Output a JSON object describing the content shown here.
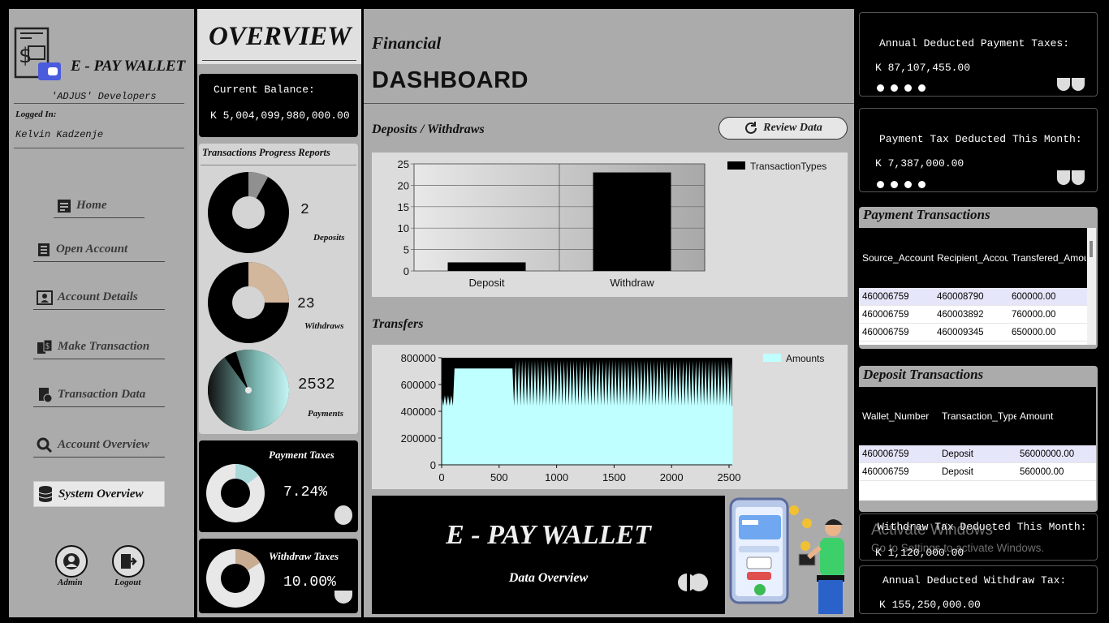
{
  "app": {
    "name": "E - PAY WALLET",
    "developers": "'ADJUS' Developers",
    "logged_in_label": "Logged In:",
    "user": "Kelvin Kadzenje"
  },
  "nav": [
    {
      "label": "Home",
      "icon": "home-icon"
    },
    {
      "label": "Open Account",
      "icon": "form-icon"
    },
    {
      "label": "Account Details",
      "icon": "id-card-icon"
    },
    {
      "label": "Make Transaction",
      "icon": "money-transfer-icon"
    },
    {
      "label": "Transaction Data",
      "icon": "document-icon"
    },
    {
      "label": "Account Overview",
      "icon": "search-icon"
    },
    {
      "label": "System Overview",
      "icon": "database-icon"
    }
  ],
  "footer": {
    "admin": "Admin",
    "logout": "Logout"
  },
  "overview": {
    "title": "OVERVIEW",
    "balance_label": "Current Balance:",
    "balance_value": "K 5,004,099,980,000.00",
    "progress_title": "Transactions Progress Reports",
    "deposits": {
      "count": "2",
      "label": "Deposits",
      "fraction": 0.08
    },
    "withdraws": {
      "count": "23",
      "label": "Withdraws",
      "fraction": 0.25
    },
    "payments": {
      "count": "2532",
      "label": "Payments",
      "fraction": 0.95
    },
    "payment_taxes": {
      "label": "Payment Taxes",
      "value": "7.24%",
      "fraction": 0.0724
    },
    "withdraw_taxes": {
      "label": "Withdraw Taxes",
      "value": "10.00%",
      "fraction": 0.1
    }
  },
  "dashboard": {
    "title_small": "Financial",
    "title_big": "DASHBOARD",
    "deposits_title": "Deposits / Withdraws",
    "review_button": "Review Data",
    "transfers_title": "Transfers",
    "banner_title": "E - PAY WALLET",
    "banner_sub": "Data Overview"
  },
  "chart_data": [
    {
      "type": "bar",
      "categories": [
        "Deposit",
        "Withdraw"
      ],
      "series": [
        {
          "name": "TransactionTypes",
          "values": [
            2,
            23
          ]
        }
      ],
      "ylim": [
        0,
        25
      ],
      "yticks": [
        "25",
        "20",
        "15",
        "10",
        "5",
        "0"
      ],
      "grid": true,
      "legend": "top-right"
    },
    {
      "type": "area",
      "series": [
        {
          "name": "Amounts"
        }
      ],
      "xlim": [
        0,
        2532
      ],
      "ylim": [
        0,
        800000
      ],
      "xticks": [
        "0",
        "500",
        "1000",
        "1500",
        "2000",
        "2500"
      ],
      "yticks": [
        "800000",
        "600000",
        "400000",
        "200000",
        "0"
      ],
      "baseline": 440000,
      "plateau": {
        "from": 100,
        "to": 620,
        "value": 720000
      },
      "oscillation_max": 800000,
      "legend": "top-right"
    }
  ],
  "taxes": {
    "annual_payment_label": "Annual Deducted Payment Taxes:",
    "annual_payment_value": "K 87,107,455.00",
    "monthly_payment_label": "Payment Tax Deducted This Month:",
    "monthly_payment_value": "K 7,387,000.00",
    "monthly_withdraw_label": "Withdraw Tax Deducted This Month:",
    "monthly_withdraw_value": "K 1,120,000.00",
    "annual_withdraw_label": "Annual Deducted Withdraw Tax:",
    "annual_withdraw_value": "K 155,250,000.00"
  },
  "payment_transactions": {
    "title": "Payment Transactions",
    "columns": [
      "Source_Account_",
      "Recipient_Accour",
      "Transfered_Amour"
    ],
    "rows": [
      [
        "460006759",
        "460008790",
        "600000.00"
      ],
      [
        "460006759",
        "460003892",
        "760000.00"
      ],
      [
        "460006759",
        "460009345",
        "650000.00"
      ]
    ]
  },
  "deposit_transactions": {
    "title": "Deposit Transactions",
    "columns": [
      "Wallet_Number",
      "Transaction_Type",
      "Amount"
    ],
    "rows": [
      [
        "460006759",
        "Deposit",
        "56000000.00"
      ],
      [
        "460006759",
        "Deposit",
        "560000.00"
      ]
    ]
  },
  "watermark": {
    "line1": "Activate Windows",
    "line2": "Go to Settings to activate Windows."
  },
  "colors": {
    "panel": "#ababab",
    "dark": "#000000",
    "area": "#bfffff",
    "accent_blue": "#4a5bdc"
  }
}
